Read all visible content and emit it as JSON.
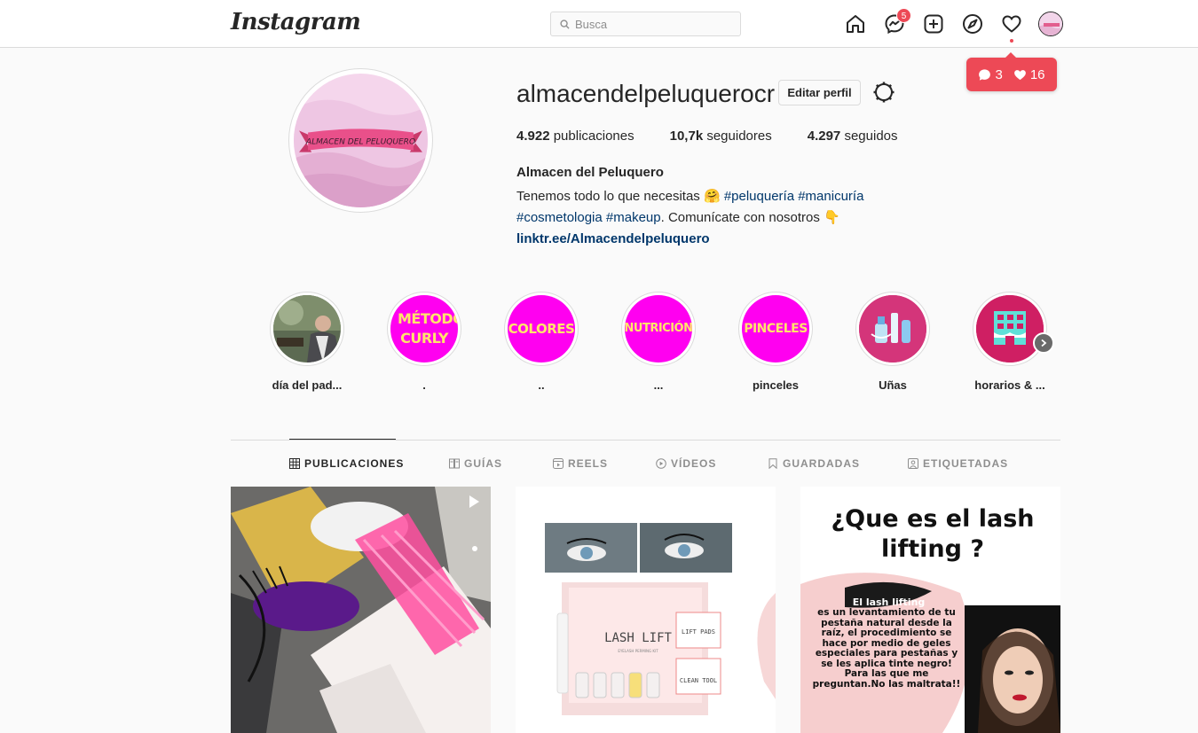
{
  "nav": {
    "logo": "Instagram",
    "search_placeholder": "Busca",
    "messages_badge": "5"
  },
  "notifications": {
    "comments": "3",
    "likes": "16"
  },
  "profile": {
    "username": "almacendelpeluquerocr",
    "edit_label": "Editar perfil",
    "avatar_text": "ALMACEN DEL PELUQUERO",
    "stats": {
      "posts_count": "4.922",
      "posts_label": "publicaciones",
      "followers_count": "10,7k",
      "followers_label": "seguidores",
      "following_count": "4.297",
      "following_label": "seguidos"
    },
    "full_name": "Almacen del Peluquero",
    "bio_line1_text": "Tenemos todo lo que necesitas 🤗 ",
    "bio_tag1": "#peluquería",
    "bio_tag2": "#manicuría",
    "bio_tag3": "#cosmetologia",
    "bio_tag4": "#makeup",
    "bio_line2_text": ". Comunícate con nosotros 👇",
    "link": "linktr.ee/Almacendelpeluquero"
  },
  "highlights": [
    {
      "label": "día del pad...",
      "cover_text": ""
    },
    {
      "label": ".",
      "cover_text": "MÉTODO CURLY"
    },
    {
      "label": "..",
      "cover_text": "COLORES"
    },
    {
      "label": "...",
      "cover_text": "NUTRICIÓN"
    },
    {
      "label": "pinceles",
      "cover_text": "PINCELES"
    },
    {
      "label": "Uñas",
      "cover_text": ""
    },
    {
      "label": "horarios & ...",
      "cover_text": ""
    }
  ],
  "tabs": [
    {
      "label": "PUBLICACIONES",
      "icon": "grid-icon"
    },
    {
      "label": "GUÍAS",
      "icon": "guide-icon"
    },
    {
      "label": "REELS",
      "icon": "reels-icon"
    },
    {
      "label": "VÍDEOS",
      "icon": "play-icon"
    },
    {
      "label": "GUARDADAS",
      "icon": "bookmark-icon"
    },
    {
      "label": "ETIQUETADAS",
      "icon": "tag-icon"
    }
  ],
  "posts": {
    "p2_title": "LASH LIFT",
    "p2_sub": "EYELASH PERMING KIT",
    "p2_pads": "LIFT PADS",
    "p2_clean": "CLEAN TOOL",
    "p3_title": "¿Que es el lash lifting ?",
    "p3_heading": "El lash lifting",
    "p3_body": "es un levantamiento de tu pestaña natural desde la raíz, el procedimiento se hace por medio de geles especiales para pestañas y se les aplica tinte negro! Para las que me preguntan.No las maltrata!!"
  },
  "colors": {
    "accent": "#ed4956",
    "link": "#00376b",
    "highlight_magenta": "#ff00f0",
    "highlight_text": "#ffe56a"
  }
}
